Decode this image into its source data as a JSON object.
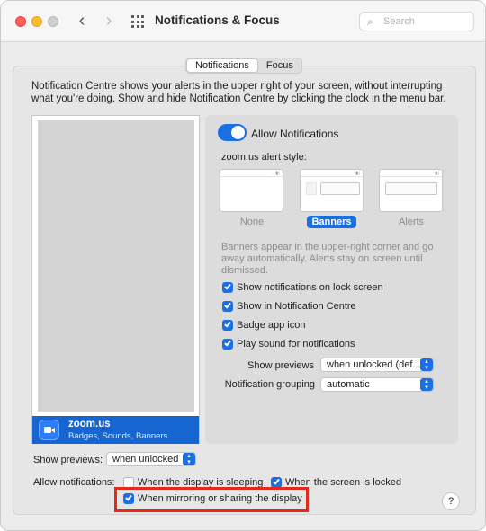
{
  "window": {
    "title": "Notifications & Focus"
  },
  "search": {
    "placeholder": "Search"
  },
  "tabs": [
    {
      "label": "Notifications",
      "active": true
    },
    {
      "label": "Focus",
      "active": false
    }
  ],
  "intro_text": "Notification Centre shows your alerts in the upper right of your screen, without interrupting what you're doing. Show and hide Notification Centre by clicking the clock in the menu bar.",
  "app_list": {
    "selected": {
      "name": "zoom.us",
      "subtitle": "Badges, Sounds, Banners",
      "icon": "video-camera-icon"
    }
  },
  "settings": {
    "allow_notifications_label": "Allow Notifications",
    "allow_notifications_on": true,
    "alert_style_label": "zoom.us alert style:",
    "alert_styles": [
      "None",
      "Banners",
      "Alerts"
    ],
    "selected_alert_style": "Banners",
    "description": "Banners appear in the upper-right corner and go away automatically. Alerts stay on screen until dismissed.",
    "checkboxes": [
      {
        "label": "Show notifications on lock screen",
        "checked": true
      },
      {
        "label": "Show in Notification Centre",
        "checked": true
      },
      {
        "label": "Badge app icon",
        "checked": true
      },
      {
        "label": "Play sound for notifications",
        "checked": true
      }
    ],
    "show_previews_label": "Show previews",
    "show_previews_value": "when unlocked (def...",
    "grouping_label": "Notification grouping",
    "grouping_value": "automatic"
  },
  "bottom": {
    "show_previews_label": "Show previews:",
    "show_previews_value": "when unlocked",
    "allow_label": "Allow notifications:",
    "options": [
      {
        "label": "When the display is sleeping",
        "checked": false
      },
      {
        "label": "When the screen is locked",
        "checked": true
      },
      {
        "label": "When mirroring or sharing the display",
        "checked": true
      }
    ]
  },
  "help_label": "?",
  "colors": {
    "accent": "#1a6fe3",
    "highlight_box": "#e42a1d",
    "selected_row": "#1765d1"
  }
}
